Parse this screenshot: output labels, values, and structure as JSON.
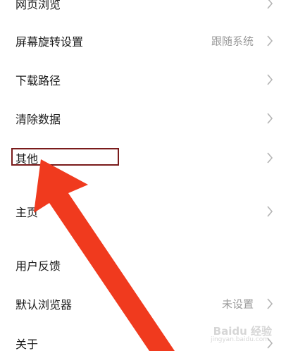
{
  "settings": {
    "items": [
      {
        "label": "网页浏览",
        "value": ""
      },
      {
        "label": "屏幕旋转设置",
        "value": "跟随系统"
      },
      {
        "label": "下载路径",
        "value": ""
      },
      {
        "label": "清除数据",
        "value": ""
      },
      {
        "label": "其他",
        "value": ""
      },
      {
        "label": "主页",
        "value": ""
      },
      {
        "label": "用户反馈",
        "value": ""
      },
      {
        "label": "默认浏览器",
        "value": "未设置"
      },
      {
        "label": "关于",
        "value": ""
      }
    ]
  },
  "annotation": {
    "box_color": "#7a1b1b",
    "arrow_color": "#f03a1e"
  },
  "watermark": {
    "text": "Baidu 经验",
    "sub": "jingyan.baidu.com"
  },
  "colors": {
    "background": "#ffffff",
    "text": "#1a1a1a",
    "secondary_text": "#9a9a9a",
    "chevron": "#b5b5b5"
  }
}
